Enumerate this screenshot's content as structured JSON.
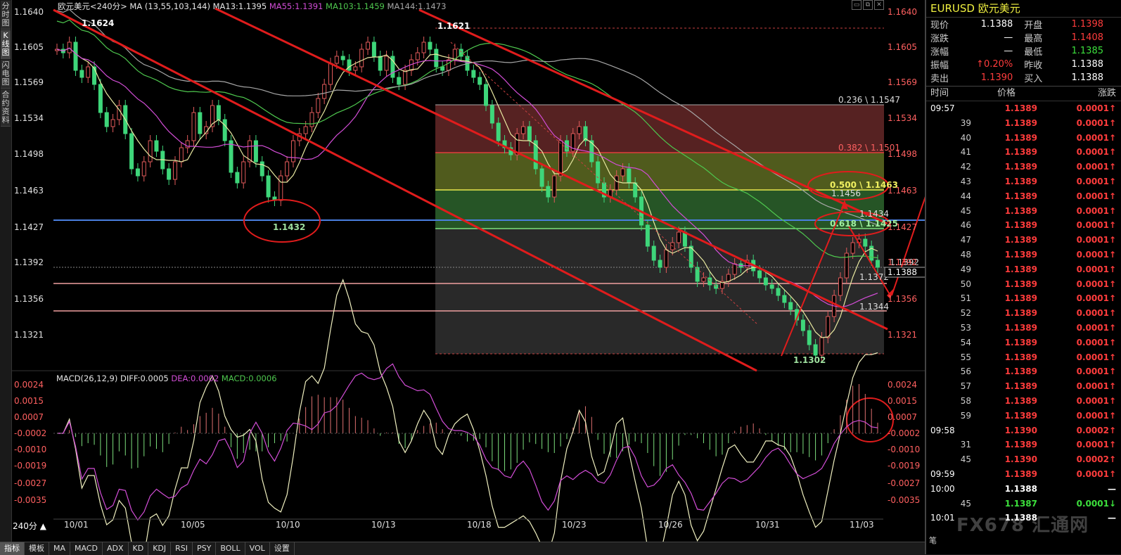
{
  "left_tabs": [
    "分时图",
    "K线图",
    "闪电图",
    "合约资料"
  ],
  "header": {
    "symbol": "欧元美元<240分>",
    "ma_label": "MA (13,55,103,144)",
    "ma13": "MA13:1.1395",
    "ma55": "MA55:1.1391",
    "ma103": "MA103:1.1459",
    "ma144": "MA144:1.1473"
  },
  "macd_header": {
    "label": "MACD(26,12,9)",
    "diff": "DIFF:0.0005",
    "dea": "DEA:0.0002",
    "macd": "MACD:0.0006"
  },
  "price_axis": [
    "1.1640",
    "1.1605",
    "1.1569",
    "1.1534",
    "1.1498",
    "1.1463",
    "1.1427",
    "1.1392",
    "1.1356",
    "1.1321"
  ],
  "price_axis_right_current": "1.1388",
  "macd_axis": [
    "0.0024",
    "0.0015",
    "0.0007",
    "-0.0002",
    "-0.0010",
    "-0.0019",
    "-0.0027",
    "-0.0035"
  ],
  "date_axis": [
    "10/01",
    "10/05",
    "10/10",
    "10/13",
    "10/18",
    "10/23",
    "10/26",
    "10/31",
    "11/03"
  ],
  "annotations": {
    "high1": "1.1624",
    "high2": "1.1621",
    "low1": "1.1432",
    "low2": "1.1302",
    "fib236": "0.236 \\ 1.1547",
    "fib382": "0.382 \\ 1.1501",
    "fib500": "0.500 \\ 1.1463",
    "fib618": "0.618 \\ 1.1425",
    "peak": "1.1456",
    "level1434": "1.1434",
    "level1392": "1.1392",
    "level1372": "1.1372",
    "level1344": "1.1344"
  },
  "period_button": "240分 ▲",
  "bottom_tabs": [
    "指标",
    "模板",
    "MA",
    "MACD",
    "ADX",
    "KD",
    "KDJ",
    "RSI",
    "PSY",
    "BOLL",
    "VOL",
    "设置"
  ],
  "quote": {
    "title": "EURUSD 欧元美元",
    "rows": [
      {
        "l1": "现价",
        "v1": "1.1388",
        "l2": "开盘",
        "v2": "1.1398"
      },
      {
        "l1": "涨跌",
        "v1": "—",
        "l2": "最高",
        "v2": "1.1408"
      },
      {
        "l1": "涨幅",
        "v1": "—",
        "l2": "最低",
        "v2": "1.1385"
      },
      {
        "l1": "振幅",
        "v1": "0.20%",
        "l2": "昨收",
        "v2": "1.1388"
      },
      {
        "l1": "卖出",
        "v1": "1.1390",
        "l2": "买入",
        "v2": "1.1388"
      }
    ]
  },
  "ticks_header": {
    "time": "时间",
    "price": "价格",
    "change": "涨跌"
  },
  "ticks": [
    {
      "t": "09:57",
      "p": "1.1389",
      "c": "0.0001",
      "dir": "up"
    },
    {
      "t": "39",
      "p": "1.1389",
      "c": "0.0001",
      "dir": "up"
    },
    {
      "t": "40",
      "p": "1.1389",
      "c": "0.0001",
      "dir": "up"
    },
    {
      "t": "41",
      "p": "1.1389",
      "c": "0.0001",
      "dir": "up"
    },
    {
      "t": "42",
      "p": "1.1389",
      "c": "0.0001",
      "dir": "up"
    },
    {
      "t": "43",
      "p": "1.1389",
      "c": "0.0001",
      "dir": "up"
    },
    {
      "t": "44",
      "p": "1.1389",
      "c": "0.0001",
      "dir": "up"
    },
    {
      "t": "45",
      "p": "1.1389",
      "c": "0.0001",
      "dir": "up"
    },
    {
      "t": "46",
      "p": "1.1389",
      "c": "0.0001",
      "dir": "up"
    },
    {
      "t": "47",
      "p": "1.1389",
      "c": "0.0001",
      "dir": "up"
    },
    {
      "t": "48",
      "p": "1.1389",
      "c": "0.0001",
      "dir": "up"
    },
    {
      "t": "49",
      "p": "1.1389",
      "c": "0.0001",
      "dir": "up"
    },
    {
      "t": "50",
      "p": "1.1389",
      "c": "0.0001",
      "dir": "up"
    },
    {
      "t": "51",
      "p": "1.1389",
      "c": "0.0001",
      "dir": "up"
    },
    {
      "t": "52",
      "p": "1.1389",
      "c": "0.0001",
      "dir": "up"
    },
    {
      "t": "53",
      "p": "1.1389",
      "c": "0.0001",
      "dir": "up"
    },
    {
      "t": "54",
      "p": "1.1389",
      "c": "0.0001",
      "dir": "up"
    },
    {
      "t": "55",
      "p": "1.1389",
      "c": "0.0001",
      "dir": "up"
    },
    {
      "t": "56",
      "p": "1.1389",
      "c": "0.0001",
      "dir": "up"
    },
    {
      "t": "57",
      "p": "1.1389",
      "c": "0.0001",
      "dir": "up"
    },
    {
      "t": "58",
      "p": "1.1389",
      "c": "0.0001",
      "dir": "up"
    },
    {
      "t": "59",
      "p": "1.1389",
      "c": "0.0001",
      "dir": "up"
    },
    {
      "t": "09:58",
      "p": "1.1390",
      "c": "0.0002",
      "dir": "up"
    },
    {
      "t": "31",
      "p": "1.1389",
      "c": "0.0001",
      "dir": "up"
    },
    {
      "t": "45",
      "p": "1.1390",
      "c": "0.0002",
      "dir": "up"
    },
    {
      "t": "09:59",
      "p": "1.1389",
      "c": "0.0001",
      "dir": "up"
    },
    {
      "t": "10:00",
      "p": "1.1388",
      "c": "—",
      "dir": "flat"
    },
    {
      "t": "45",
      "p": "1.1387",
      "c": "0.0001",
      "dir": "down"
    },
    {
      "t": "10:01",
      "p": "1.1388",
      "c": "—",
      "dir": "flat"
    }
  ],
  "right_bottom": "笔",
  "watermark": "FX678 汇通网"
}
